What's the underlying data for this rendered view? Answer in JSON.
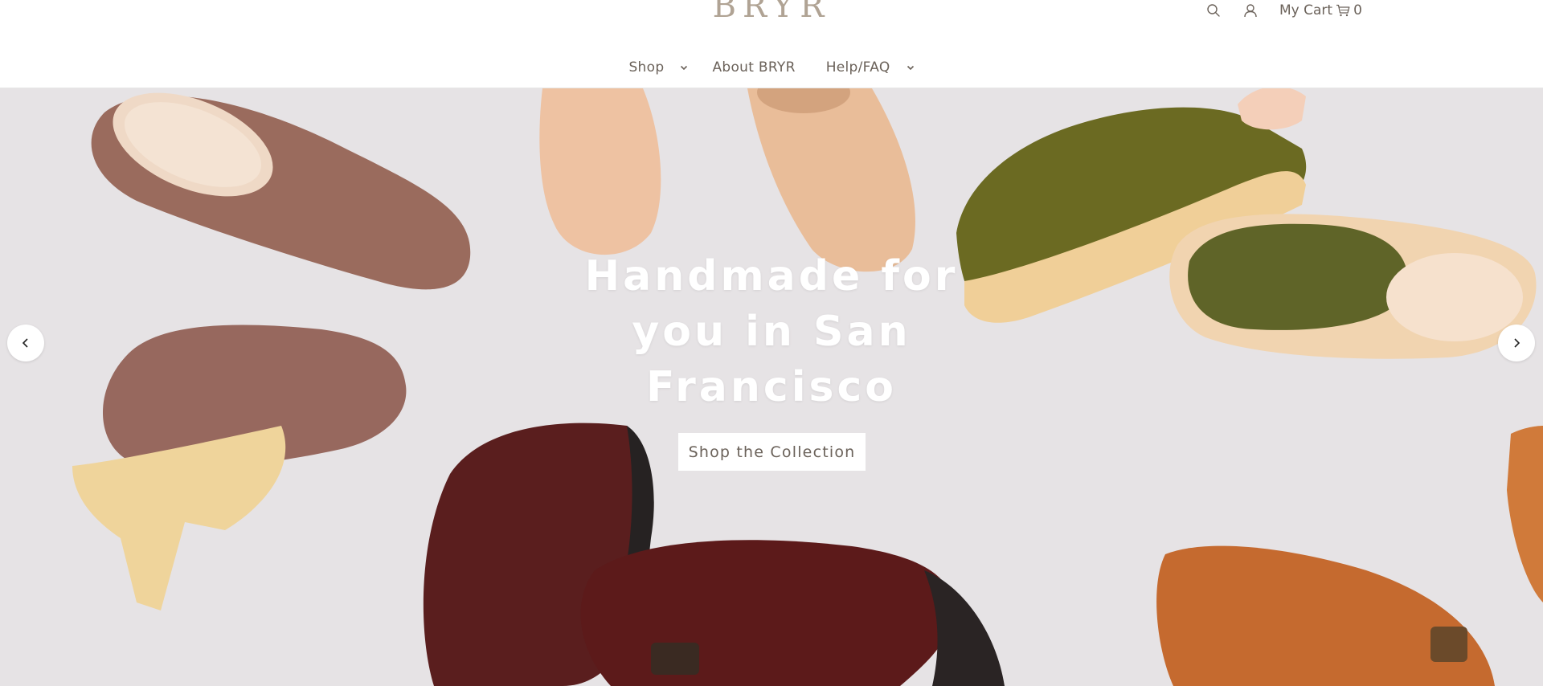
{
  "header": {
    "logo_text": "BRYR",
    "cart_label": "My Cart",
    "cart_count": "0",
    "icons": {
      "search": "search-icon",
      "account": "user-icon",
      "cart": "cart-icon"
    }
  },
  "nav": {
    "items": [
      {
        "label": "Shop",
        "has_dropdown": true
      },
      {
        "label": "About BRYR",
        "has_dropdown": false
      },
      {
        "label": "Help/FAQ",
        "has_dropdown": true
      }
    ]
  },
  "hero": {
    "title": "Handmade for you in San Francisco",
    "cta_label": "Shop the Collection",
    "prev_icon": "chevron-left-icon",
    "next_icon": "chevron-right-icon"
  },
  "colors": {
    "text_muted": "#6b625a",
    "logo": "#b0a394",
    "hero_background": "#e6e3e5",
    "white": "#ffffff"
  }
}
